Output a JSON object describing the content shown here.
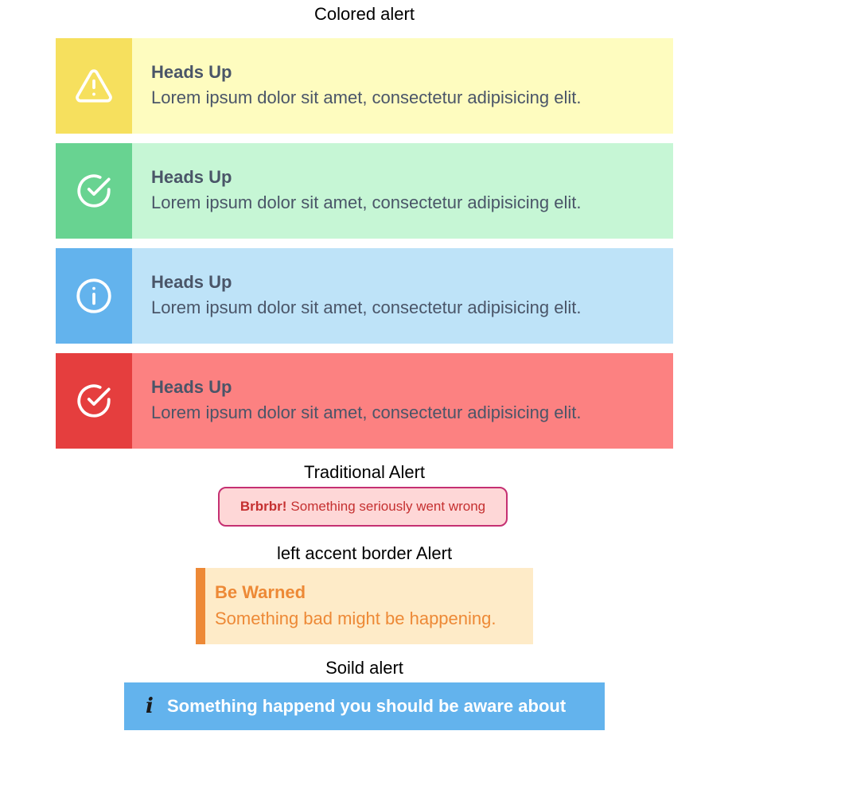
{
  "sections": {
    "colored_title": "Colored alert",
    "traditional_title": "Traditional Alert",
    "accent_title": "left accent border Alert",
    "solid_title": "Soild alert"
  },
  "colored_alerts": [
    {
      "heading": "Heads Up",
      "body": "Lorem ipsum dolor sit amet, consectetur adipisicing elit.",
      "icon": "warning-triangle-icon",
      "icon_bg": "#f6e05e",
      "bg": "#fefcbf"
    },
    {
      "heading": "Heads Up",
      "body": "Lorem ipsum dolor sit amet, consectetur adipisicing elit.",
      "icon": "check-circle-icon",
      "icon_bg": "#68d391",
      "bg": "#c6f6d5"
    },
    {
      "heading": "Heads Up",
      "body": "Lorem ipsum dolor sit amet, consectetur adipisicing elit.",
      "icon": "info-circle-icon",
      "icon_bg": "#63b3ed",
      "bg": "#bee3f8"
    },
    {
      "heading": "Heads Up",
      "body": "Lorem ipsum dolor sit amet, consectetur adipisicing elit.",
      "icon": "check-circle-icon",
      "icon_bg": "#e53e3e",
      "bg": "#fc8181"
    }
  ],
  "traditional_alert": {
    "strong": "Brbrbr!",
    "message": "Something seriously went wrong"
  },
  "accent_alert": {
    "heading": "Be Warned",
    "body": "Something bad might be happening."
  },
  "solid_alert": {
    "icon": "info-icon",
    "message": "Something happend you should be aware about"
  }
}
